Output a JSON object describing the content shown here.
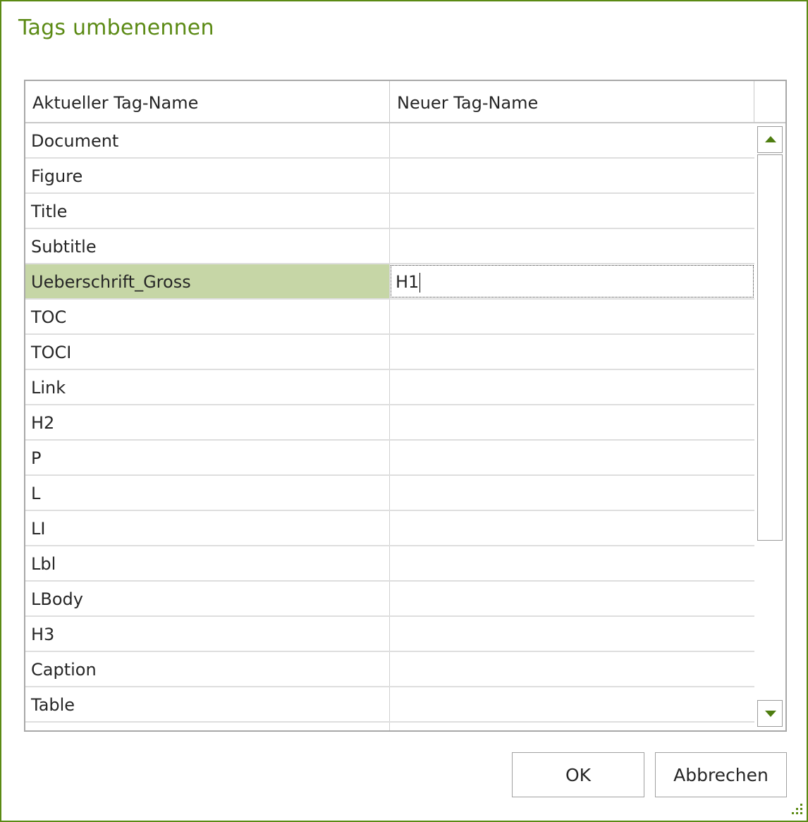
{
  "dialog": {
    "title": "Tags umbenennen"
  },
  "table": {
    "columns": [
      "Aktueller Tag-Name",
      "Neuer Tag-Name"
    ],
    "rows": [
      {
        "current": "Document",
        "new": ""
      },
      {
        "current": "Figure",
        "new": ""
      },
      {
        "current": "Title",
        "new": ""
      },
      {
        "current": "Subtitle",
        "new": ""
      },
      {
        "current": "Ueberschrift_Gross",
        "new": "H1",
        "selected": true
      },
      {
        "current": "TOC",
        "new": ""
      },
      {
        "current": "TOCI",
        "new": ""
      },
      {
        "current": "Link",
        "new": ""
      },
      {
        "current": "H2",
        "new": ""
      },
      {
        "current": "P",
        "new": ""
      },
      {
        "current": "L",
        "new": ""
      },
      {
        "current": "LI",
        "new": ""
      },
      {
        "current": "Lbl",
        "new": ""
      },
      {
        "current": "LBody",
        "new": ""
      },
      {
        "current": "H3",
        "new": ""
      },
      {
        "current": "Caption",
        "new": ""
      },
      {
        "current": "Table",
        "new": ""
      },
      {
        "current": "",
        "new": ""
      }
    ]
  },
  "buttons": {
    "ok": "OK",
    "cancel": "Abbrechen"
  },
  "icons": {
    "scroll_up": "triangle-up-icon",
    "scroll_down": "triangle-down-icon",
    "resize_grip": "resize-grip-icon"
  },
  "colors": {
    "accent": "#5b8a14",
    "selection": "#c6d6a6",
    "border": "#a8a8a8"
  }
}
